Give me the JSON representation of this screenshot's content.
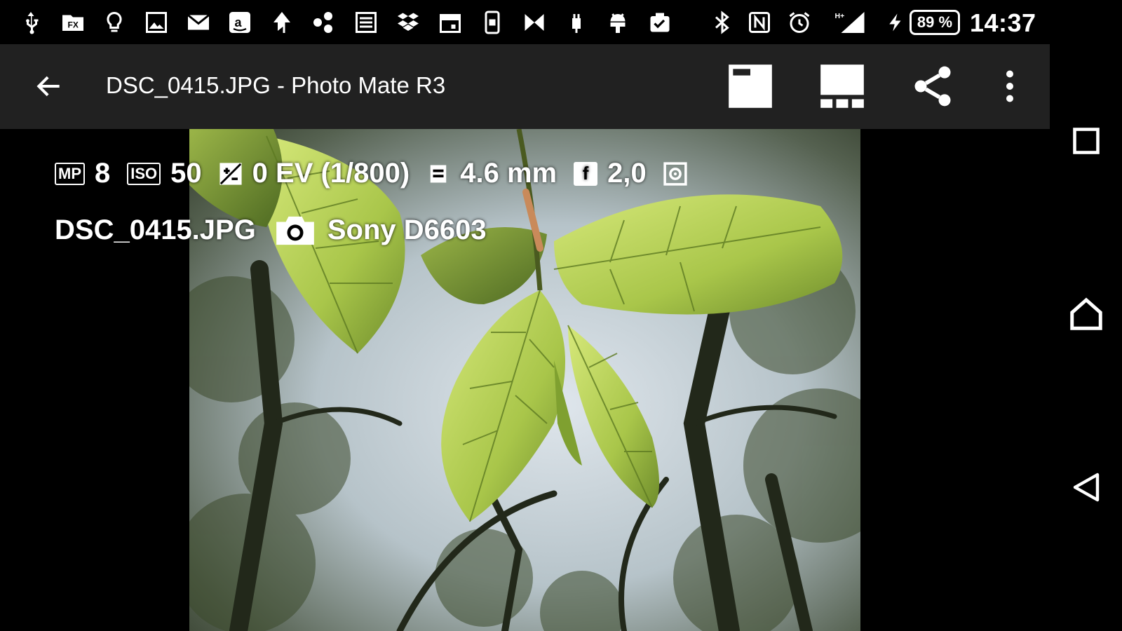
{
  "status_bar": {
    "left_icons": [
      "usb-icon",
      "fx-file-manager-icon",
      "lightbulb-icon",
      "gallery-icon",
      "mail-icon",
      "amazon-icon",
      "send-icon",
      "share-alt-icon",
      "news-icon",
      "dropbox-icon",
      "calendar-icon",
      "phone-sync-icon",
      "xperia-icon",
      "plug-icon",
      "android-icon",
      "clipboard-check-icon"
    ],
    "right_icons": [
      "bluetooth-icon",
      "nfc-icon",
      "alarm-icon",
      "signal-icon"
    ],
    "network_label": "H+",
    "battery": "89 %",
    "time": "14:37"
  },
  "toolbar": {
    "title": "DSC_0415.JPG - Photo Mate R3"
  },
  "overlay": {
    "mp_badge": "MP",
    "mp_value": "8",
    "iso_badge": "ISO",
    "iso_value": "50",
    "ev_value": "0 EV (1/800)",
    "focal_value": "4.6 mm",
    "f_badge": "f",
    "aperture_value": "2,0",
    "filename": "DSC_0415.JPG",
    "camera": "Sony D6603"
  },
  "colors": {
    "toolbar_bg": "#212121",
    "background": "#000000",
    "foreground": "#ffffff"
  }
}
